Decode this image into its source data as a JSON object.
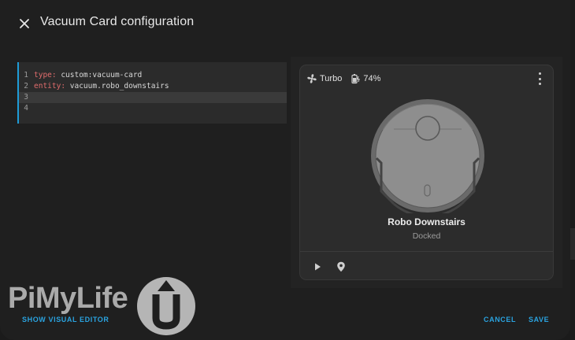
{
  "dialog": {
    "title": "Vacuum Card configuration",
    "close_icon": "close-icon"
  },
  "editor": {
    "lines": [
      {
        "num": "1",
        "key": "type:",
        "value": " custom:vacuum-card"
      },
      {
        "num": "2",
        "key": "entity:",
        "value": " vacuum.robo_downstairs"
      },
      {
        "num": "3",
        "key": "",
        "value": ""
      },
      {
        "num": "4",
        "key": "",
        "value": ""
      }
    ]
  },
  "card": {
    "fan_speed": "Turbo",
    "fan_icon": "fan-icon",
    "battery": "74%",
    "battery_icon": "battery-charging-icon",
    "menu_icon": "more-vertical-icon",
    "name": "Robo Downstairs",
    "state": "Docked",
    "actions": [
      {
        "icon": "play-icon"
      },
      {
        "icon": "map-marker-icon"
      }
    ]
  },
  "footer": {
    "show_visual_editor": "SHOW VISUAL EDITOR",
    "cancel": "CANCEL",
    "save": "SAVE"
  },
  "watermark": {
    "text": "PiMyLife",
    "badge": "Up"
  },
  "colors": {
    "accent": "#2aa3e0",
    "editor_cursor": "#1e9bd7",
    "yaml_key": "#e06c6c"
  }
}
